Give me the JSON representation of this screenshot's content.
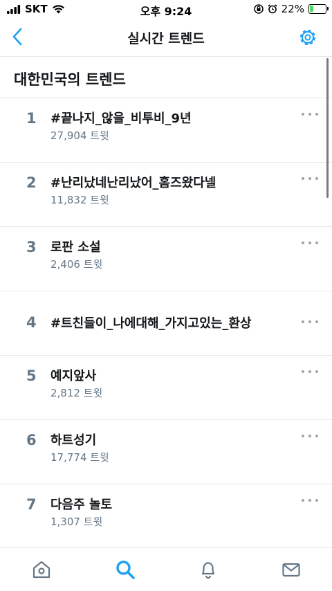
{
  "status_bar": {
    "carrier": "SKT",
    "time": "오후 9:24",
    "battery_percent": "22%",
    "battery_level": 0.22,
    "icons": [
      "signal-icon",
      "wifi-icon",
      "orientation-lock-icon",
      "alarm-icon",
      "battery-icon"
    ]
  },
  "nav": {
    "title": "실시간 트렌드",
    "back_icon": "chevron-left-icon",
    "settings_icon": "gear-icon"
  },
  "section": {
    "title": "대한민국의 트렌드"
  },
  "trends": [
    {
      "rank": "1",
      "name": "#끝나지_않을_비투비_9년",
      "count": "27,904 트윗"
    },
    {
      "rank": "2",
      "name": "#난리났네난리났어_홈즈왔다넬",
      "count": "11,832 트윗"
    },
    {
      "rank": "3",
      "name": "로판 소설",
      "count": "2,406 트윗"
    },
    {
      "rank": "4",
      "name": "#트친들이_나에대해_가지고있는_환상",
      "count": ""
    },
    {
      "rank": "5",
      "name": "예지앞사",
      "count": "2,812 트윗"
    },
    {
      "rank": "6",
      "name": "하트성기",
      "count": "17,774 트윗"
    },
    {
      "rank": "7",
      "name": "다음주 놀토",
      "count": "1,307 트윗"
    }
  ],
  "tab_bar": {
    "tabs": [
      "home-icon",
      "search-icon",
      "notifications-icon",
      "messages-icon"
    ],
    "active": "search-icon"
  },
  "colors": {
    "accent": "#1da1f2",
    "text_primary": "#14171a",
    "text_secondary": "#657786",
    "divider": "#e1e8ed"
  }
}
